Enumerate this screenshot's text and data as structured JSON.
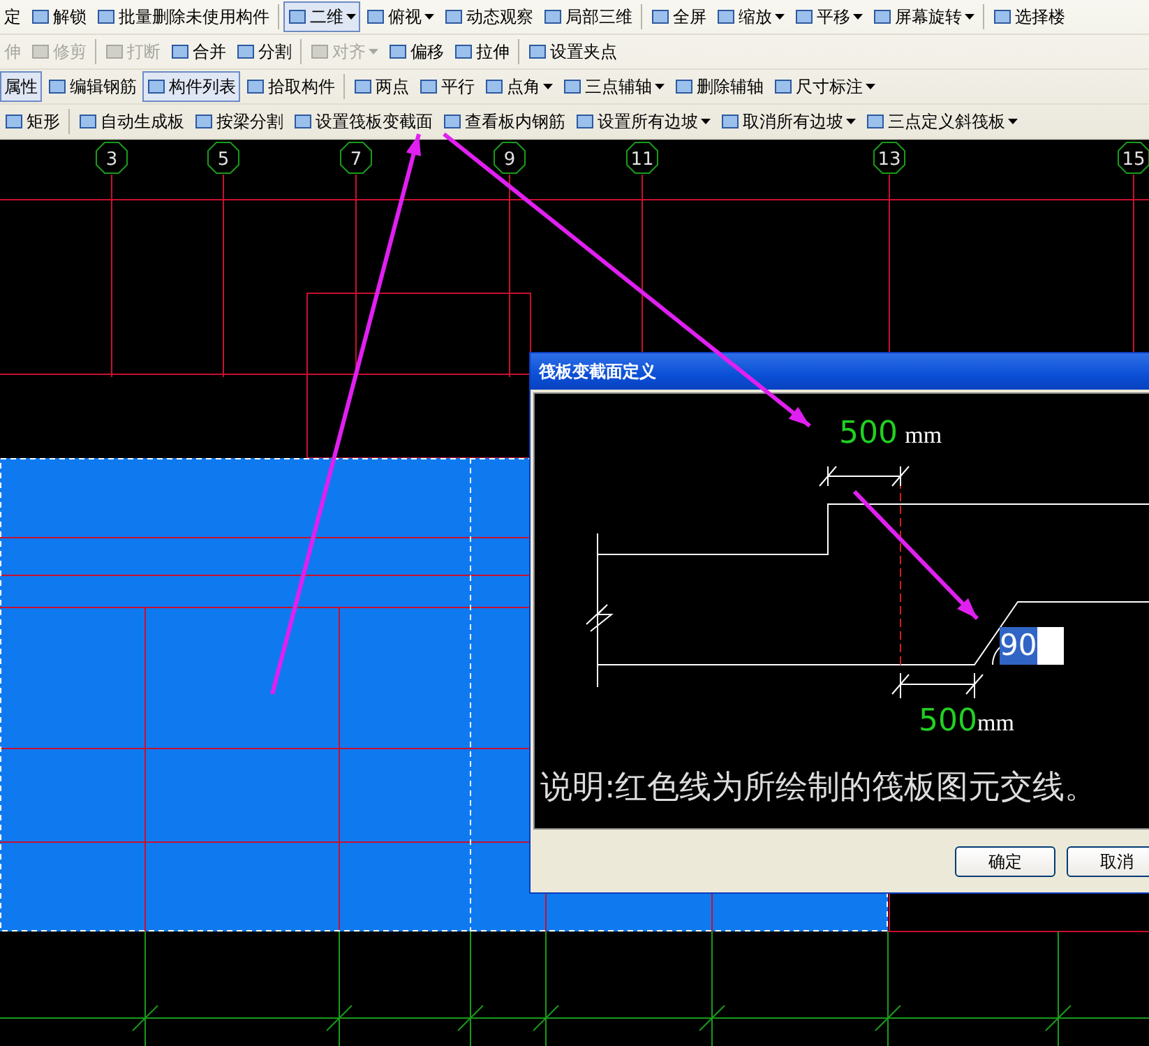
{
  "toolbars": [
    {
      "items": [
        {
          "kind": "button",
          "label": "定",
          "icon": false,
          "dropdown": false,
          "selected": false,
          "disabled": false
        },
        {
          "kind": "button",
          "label": "解锁",
          "icon": true,
          "dropdown": false,
          "selected": false,
          "disabled": false
        },
        {
          "kind": "button",
          "label": "批量删除未使用构件",
          "icon": true,
          "dropdown": false,
          "selected": false,
          "disabled": false
        },
        {
          "kind": "separator"
        },
        {
          "kind": "button",
          "label": "二维",
          "icon": true,
          "dropdown": true,
          "selected": true,
          "disabled": false
        },
        {
          "kind": "button",
          "label": "俯视",
          "icon": true,
          "dropdown": true,
          "selected": false,
          "disabled": false
        },
        {
          "kind": "button",
          "label": "动态观察",
          "icon": true,
          "dropdown": false,
          "selected": false,
          "disabled": false
        },
        {
          "kind": "button",
          "label": "局部三维",
          "icon": true,
          "dropdown": false,
          "selected": false,
          "disabled": false
        },
        {
          "kind": "separator"
        },
        {
          "kind": "button",
          "label": "全屏",
          "icon": true,
          "dropdown": false,
          "selected": false,
          "disabled": false
        },
        {
          "kind": "button",
          "label": "缩放",
          "icon": true,
          "dropdown": true,
          "selected": false,
          "disabled": false
        },
        {
          "kind": "button",
          "label": "平移",
          "icon": true,
          "dropdown": true,
          "selected": false,
          "disabled": false
        },
        {
          "kind": "button",
          "label": "屏幕旋转",
          "icon": true,
          "dropdown": true,
          "selected": false,
          "disabled": false
        },
        {
          "kind": "separator"
        },
        {
          "kind": "button",
          "label": "选择楼",
          "icon": true,
          "dropdown": false,
          "selected": false,
          "disabled": false
        }
      ]
    },
    {
      "items": [
        {
          "kind": "button",
          "label": "伸",
          "icon": false,
          "dropdown": false,
          "selected": false,
          "disabled": true
        },
        {
          "kind": "button",
          "label": "修剪",
          "icon": true,
          "dropdown": false,
          "selected": false,
          "disabled": true
        },
        {
          "kind": "separator"
        },
        {
          "kind": "button",
          "label": "打断",
          "icon": true,
          "dropdown": false,
          "selected": false,
          "disabled": true
        },
        {
          "kind": "button",
          "label": "合并",
          "icon": true,
          "dropdown": false,
          "selected": false,
          "disabled": false
        },
        {
          "kind": "button",
          "label": "分割",
          "icon": true,
          "dropdown": false,
          "selected": false,
          "disabled": false
        },
        {
          "kind": "separator"
        },
        {
          "kind": "button",
          "label": "对齐",
          "icon": true,
          "dropdown": true,
          "selected": false,
          "disabled": true
        },
        {
          "kind": "button",
          "label": "偏移",
          "icon": true,
          "dropdown": false,
          "selected": false,
          "disabled": false
        },
        {
          "kind": "button",
          "label": "拉伸",
          "icon": true,
          "dropdown": false,
          "selected": false,
          "disabled": false
        },
        {
          "kind": "separator"
        },
        {
          "kind": "button",
          "label": "设置夹点",
          "icon": true,
          "dropdown": false,
          "selected": false,
          "disabled": false
        }
      ]
    },
    {
      "items": [
        {
          "kind": "button",
          "label": "属性",
          "icon": false,
          "dropdown": false,
          "selected": true,
          "disabled": false
        },
        {
          "kind": "button",
          "label": "编辑钢筋",
          "icon": true,
          "dropdown": false,
          "selected": false,
          "disabled": false
        },
        {
          "kind": "button",
          "label": "构件列表",
          "icon": true,
          "dropdown": false,
          "selected": true,
          "disabled": false
        },
        {
          "kind": "button",
          "label": "拾取构件",
          "icon": true,
          "dropdown": false,
          "selected": false,
          "disabled": false
        },
        {
          "kind": "separator"
        },
        {
          "kind": "button",
          "label": "两点",
          "icon": true,
          "dropdown": false,
          "selected": false,
          "disabled": false
        },
        {
          "kind": "button",
          "label": "平行",
          "icon": true,
          "dropdown": false,
          "selected": false,
          "disabled": false
        },
        {
          "kind": "button",
          "label": "点角",
          "icon": true,
          "dropdown": true,
          "selected": false,
          "disabled": false
        },
        {
          "kind": "button",
          "label": "三点辅轴",
          "icon": true,
          "dropdown": true,
          "selected": false,
          "disabled": false
        },
        {
          "kind": "button",
          "label": "删除辅轴",
          "icon": true,
          "dropdown": false,
          "selected": false,
          "disabled": false
        },
        {
          "kind": "button",
          "label": "尺寸标注",
          "icon": true,
          "dropdown": true,
          "selected": false,
          "disabled": false
        }
      ]
    },
    {
      "items": [
        {
          "kind": "button",
          "label": "矩形",
          "icon": true,
          "dropdown": false,
          "selected": false,
          "disabled": false
        },
        {
          "kind": "separator"
        },
        {
          "kind": "button",
          "label": "自动生成板",
          "icon": true,
          "dropdown": false,
          "selected": false,
          "disabled": false
        },
        {
          "kind": "button",
          "label": "按梁分割",
          "icon": true,
          "dropdown": false,
          "selected": false,
          "disabled": false
        },
        {
          "kind": "button",
          "label": "设置筏板变截面",
          "icon": true,
          "dropdown": false,
          "selected": false,
          "disabled": false
        },
        {
          "kind": "button",
          "label": "查看板内钢筋",
          "icon": true,
          "dropdown": false,
          "selected": false,
          "disabled": false
        },
        {
          "kind": "button",
          "label": "设置所有边坡",
          "icon": true,
          "dropdown": true,
          "selected": false,
          "disabled": false
        },
        {
          "kind": "button",
          "label": "取消所有边坡",
          "icon": true,
          "dropdown": true,
          "selected": false,
          "disabled": false
        },
        {
          "kind": "button",
          "label": "三点定义斜筏板",
          "icon": true,
          "dropdown": true,
          "selected": false,
          "disabled": false
        }
      ]
    }
  ],
  "canvas": {
    "axis_labels": [
      "3",
      "5",
      "7",
      "9",
      "11",
      "13",
      "15"
    ]
  },
  "dialog": {
    "title": "筏板变截面定义",
    "top_dimension": {
      "value": "500",
      "unit": "mm"
    },
    "bottom_dimension": {
      "value": "500",
      "unit": "mm"
    },
    "angle_input": {
      "value": "90"
    },
    "note": "说明:红色线为所绘制的筏板图元交线。",
    "buttons": [
      "确定",
      "取消"
    ]
  }
}
